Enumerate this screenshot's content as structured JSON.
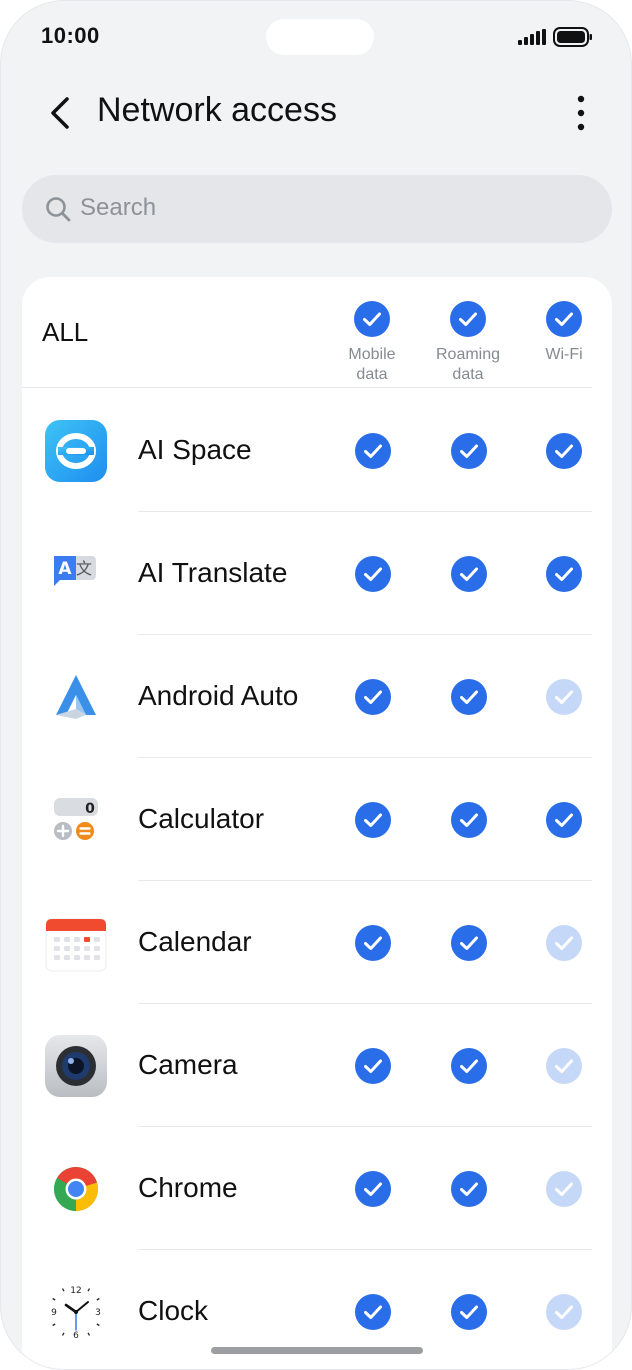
{
  "status_bar": {
    "time": "10:00"
  },
  "header": {
    "title": "Network access"
  },
  "search": {
    "placeholder": "Search"
  },
  "columns": [
    {
      "line1": "Mobile",
      "line2": "data"
    },
    {
      "line1": "Roaming",
      "line2": "data"
    },
    {
      "line1": "Wi-Fi",
      "line2": ""
    }
  ],
  "all": {
    "label": "ALL",
    "mobile": true,
    "roaming": true,
    "wifi": true
  },
  "apps": [
    {
      "name": "AI Space",
      "icon": "ai-space-icon",
      "mobile": true,
      "roaming": true,
      "wifi": true,
      "wifi_enabled": true
    },
    {
      "name": "AI Translate",
      "icon": "ai-translate-icon",
      "mobile": true,
      "roaming": true,
      "wifi": true,
      "wifi_enabled": true
    },
    {
      "name": "Android Auto",
      "icon": "android-auto-icon",
      "mobile": true,
      "roaming": true,
      "wifi": true,
      "wifi_enabled": false
    },
    {
      "name": "Calculator",
      "icon": "calculator-icon",
      "mobile": true,
      "roaming": true,
      "wifi": true,
      "wifi_enabled": true
    },
    {
      "name": "Calendar",
      "icon": "calendar-icon",
      "mobile": true,
      "roaming": true,
      "wifi": true,
      "wifi_enabled": false
    },
    {
      "name": "Camera",
      "icon": "camera-icon",
      "mobile": true,
      "roaming": true,
      "wifi": true,
      "wifi_enabled": false
    },
    {
      "name": "Chrome",
      "icon": "chrome-icon",
      "mobile": true,
      "roaming": true,
      "wifi": true,
      "wifi_enabled": false
    },
    {
      "name": "Clock",
      "icon": "clock-icon",
      "mobile": true,
      "roaming": true,
      "wifi": true,
      "wifi_enabled": false
    }
  ],
  "colors": {
    "accent": "#2a6de8",
    "accent_disabled": "#c6d8f8",
    "background": "#f1f3f5",
    "card": "#ffffff"
  }
}
